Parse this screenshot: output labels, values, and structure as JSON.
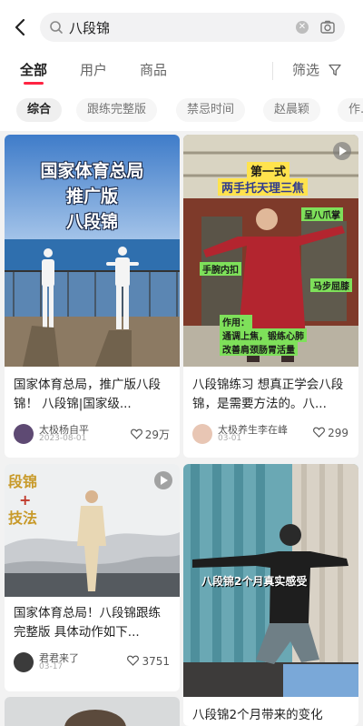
{
  "search": {
    "query": "八段锦"
  },
  "tabs": [
    {
      "label": "全部"
    },
    {
      "label": "用户"
    },
    {
      "label": "商品"
    }
  ],
  "filter": {
    "label": "筛选"
  },
  "chips": [
    {
      "label": "综合"
    },
    {
      "label": "跟练完整版"
    },
    {
      "label": "禁忌时间"
    },
    {
      "label": "赵晨颖"
    },
    {
      "label": "作..."
    }
  ],
  "cards": [
    {
      "cover_text": [
        "国家体育总局",
        "推广版",
        "八段锦"
      ],
      "title": "国家体育总局，推广版八段锦！ 八段锦|国家级...",
      "author": "太极杨自平",
      "date": "2023-08-01",
      "likes": "29万"
    },
    {
      "cover_text": [
        "第一式",
        "两手托天理三焦",
        "呈八爪掌",
        "手腕内扣",
        "马步屈膝",
        "作用：",
        "通调上焦，锻练心肺",
        "改善肩颈肠胃活量"
      ],
      "title": "八段锦练习 想真正学会八段锦，是需要方法的。八...",
      "author": "太极养生李在峰",
      "date": "03-01",
      "likes": "299"
    },
    {
      "cover_text": [
        "段锦",
        "+",
        "技法"
      ],
      "title": "国家体育总局！八段锦跟练完整版 具体动作如下...",
      "author": "君君来了",
      "date": "03-17",
      "likes": "3751"
    },
    {
      "cover_text": [
        "八段锦2个月真实感受"
      ],
      "title": "八段锦2个月带来的变化",
      "author": "",
      "date": "",
      "likes": ""
    }
  ],
  "colors": {
    "accent": "#ff2442",
    "cover_sky": "#5d8fd0",
    "cover_red": "#b3252f"
  }
}
